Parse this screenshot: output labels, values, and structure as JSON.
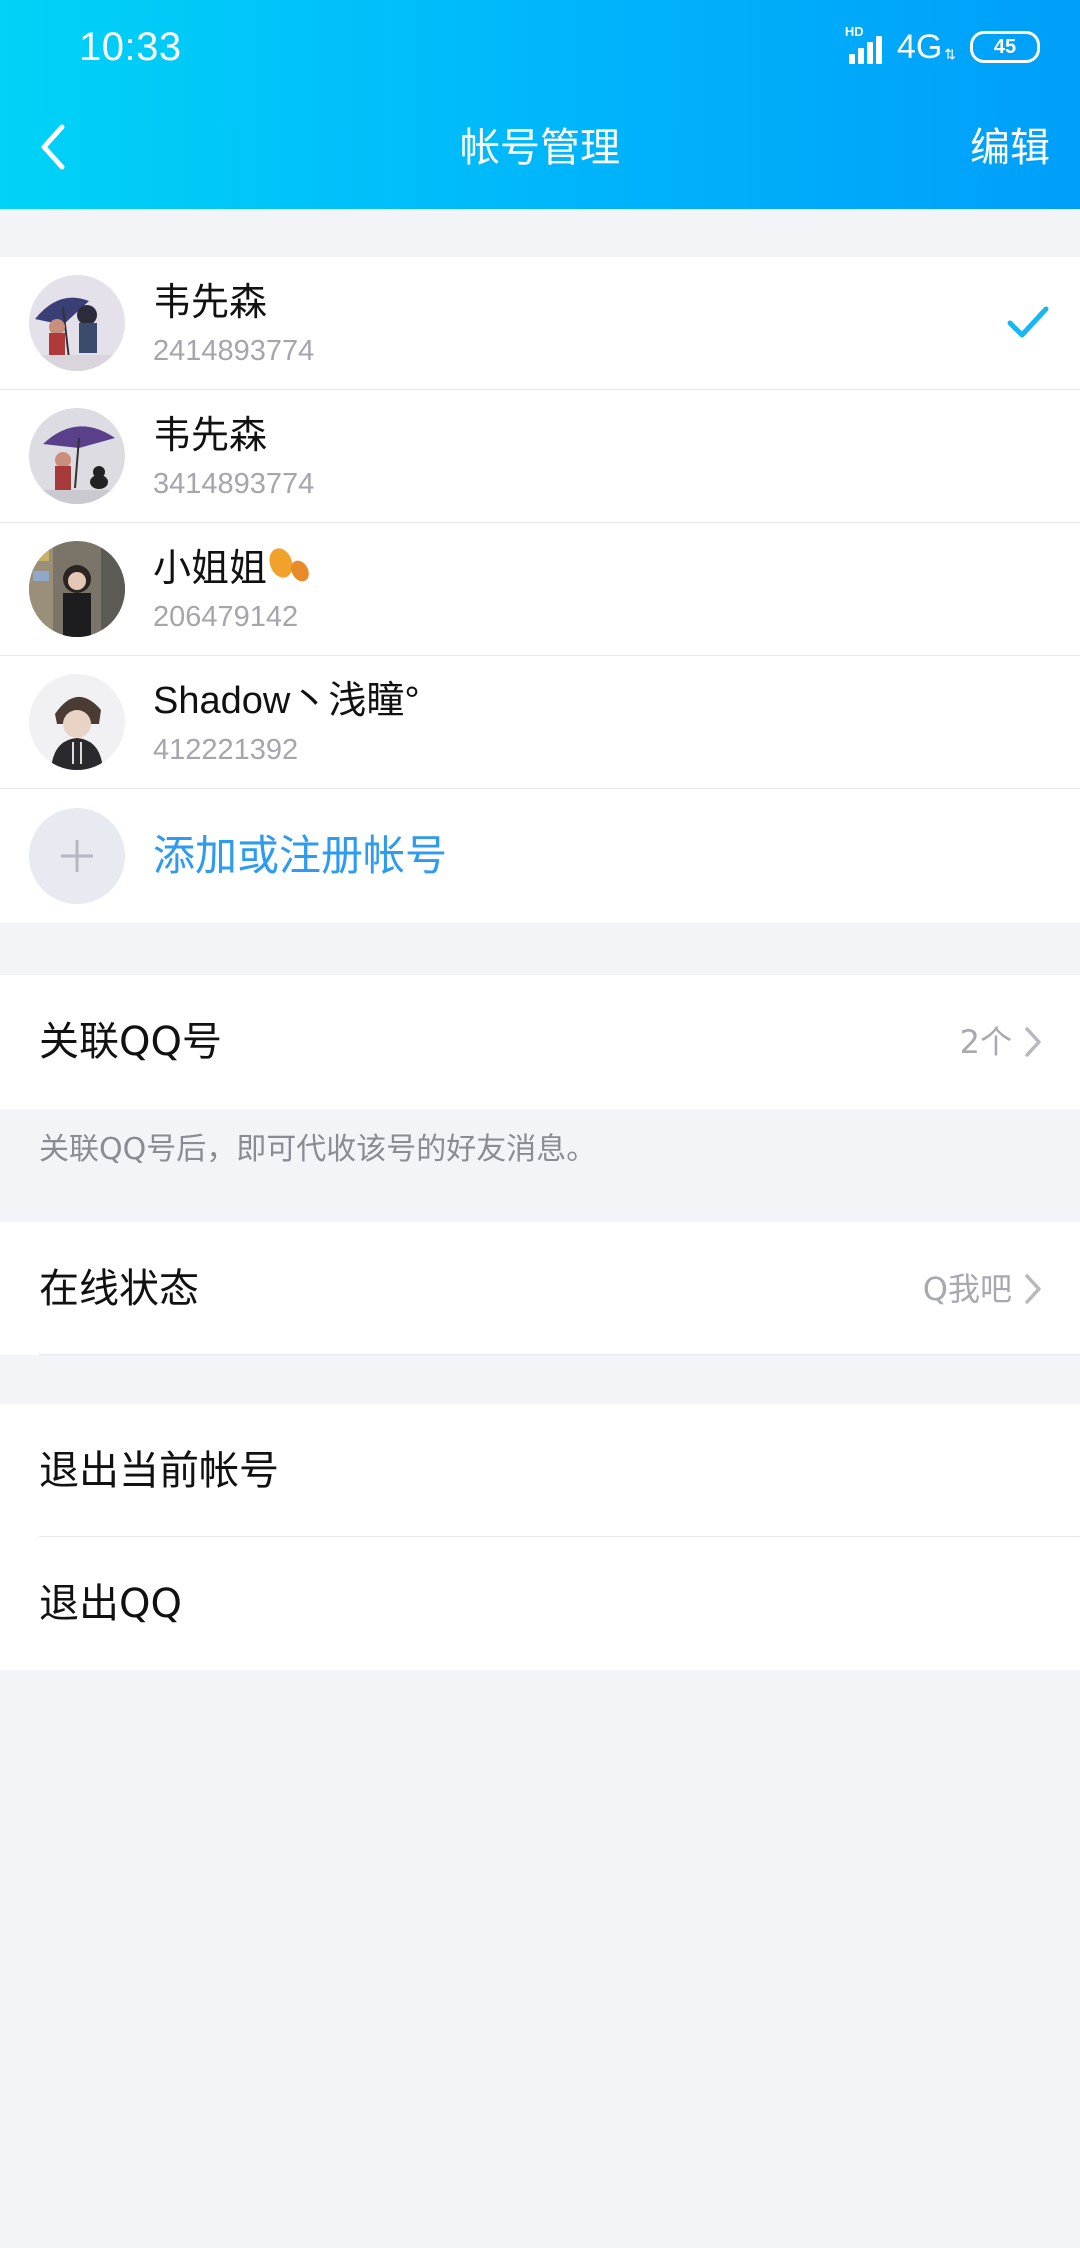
{
  "status_bar": {
    "time": "10:33",
    "hd_label": "HD",
    "network": "4G",
    "battery": "45"
  },
  "header": {
    "title": "帐号管理",
    "edit_label": "编辑",
    "back_icon": "chevron-left-icon"
  },
  "accounts": [
    {
      "name": "韦先森",
      "number": "2414893774",
      "selected": true
    },
    {
      "name": "韦先森",
      "number": "3414893774",
      "selected": false
    },
    {
      "name": "小姐姐",
      "number": "206479142",
      "selected": false
    },
    {
      "name": "Shadow丶浅瞳°",
      "number": "412221392",
      "selected": false
    }
  ],
  "add_account": {
    "label": "添加或注册帐号",
    "icon": "plus-icon"
  },
  "linked_qq": {
    "label": "关联QQ号",
    "value": "2个",
    "hint": "关联QQ号后，即可代收该号的好友消息。"
  },
  "online_status": {
    "label": "在线状态",
    "value": "Q我吧"
  },
  "logout": {
    "current_account": "退出当前帐号",
    "quit_qq": "退出QQ"
  },
  "colors": {
    "header_start": "#00d3f7",
    "header_end": "#009ff9",
    "accent_blue": "#2d9bef",
    "check_blue": "#17b6f5",
    "background": "#f3f4f8"
  }
}
